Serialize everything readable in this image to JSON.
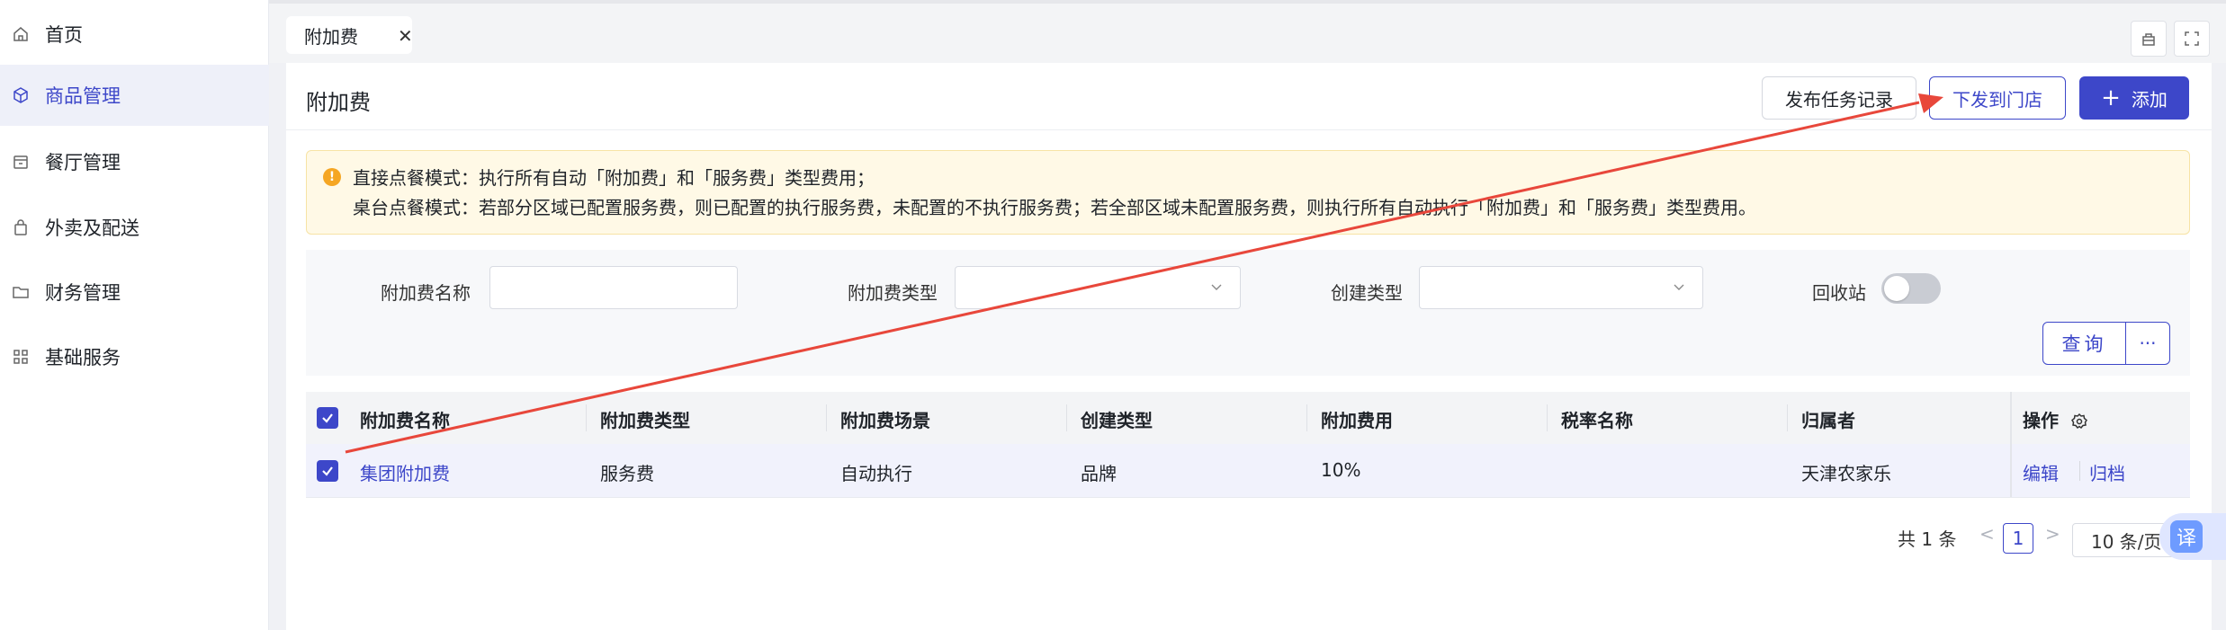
{
  "sidebar": {
    "items": [
      {
        "label": "首页",
        "icon": "home-icon",
        "active": false
      },
      {
        "label": "商品管理",
        "icon": "cube-icon",
        "active": true
      },
      {
        "label": "餐厅管理",
        "icon": "store-icon",
        "active": false
      },
      {
        "label": "外卖及配送",
        "icon": "bag-icon",
        "active": false
      },
      {
        "label": "财务管理",
        "icon": "folder-icon",
        "active": false
      },
      {
        "label": "基础服务",
        "icon": "grid-icon",
        "active": false
      }
    ]
  },
  "tabs": [
    {
      "label": "附加费",
      "close": "✕"
    }
  ],
  "header": {
    "title": "附加费",
    "publish_record_label": "发布任务记录",
    "dispatch_label": "下发到门店",
    "add_label": "添加"
  },
  "notice": {
    "line1": "直接点餐模式：执行所有自动「附加费」和「服务费」类型费用；",
    "line2": "桌台点餐模式：若部分区域已配置服务费，则已配置的执行服务费，未配置的不执行服务费；若全部区域未配置服务费，则执行所有自动执行「附加费」和「服务费」类型费用。"
  },
  "filter": {
    "name_label": "附加费名称",
    "name_value": "",
    "type_label": "附加费类型",
    "type_value": "",
    "create_label": "创建类型",
    "create_value": "",
    "recycle_label": "回收站",
    "recycle_on": false,
    "query_label": "查询",
    "more_label": "···"
  },
  "table": {
    "columns": [
      "附加费名称",
      "附加费类型",
      "附加费场景",
      "创建类型",
      "附加费用",
      "税率名称",
      "归属者",
      "操作"
    ],
    "rows": [
      {
        "name": "集团附加费",
        "type": "服务费",
        "scene": "自动执行",
        "create": "品牌",
        "fee": "10%",
        "tax": "",
        "owner": "天津农家乐",
        "edit": "编辑",
        "archive": "归档"
      }
    ]
  },
  "pagination": {
    "total": "共 1 条",
    "prev": "<",
    "page": "1",
    "next": ">",
    "size": "10 条/页"
  },
  "translate": {
    "label": "译"
  },
  "colors": {
    "accent": "#3d47c9",
    "annotation": "#e8473b",
    "warning": "#f5a623"
  }
}
